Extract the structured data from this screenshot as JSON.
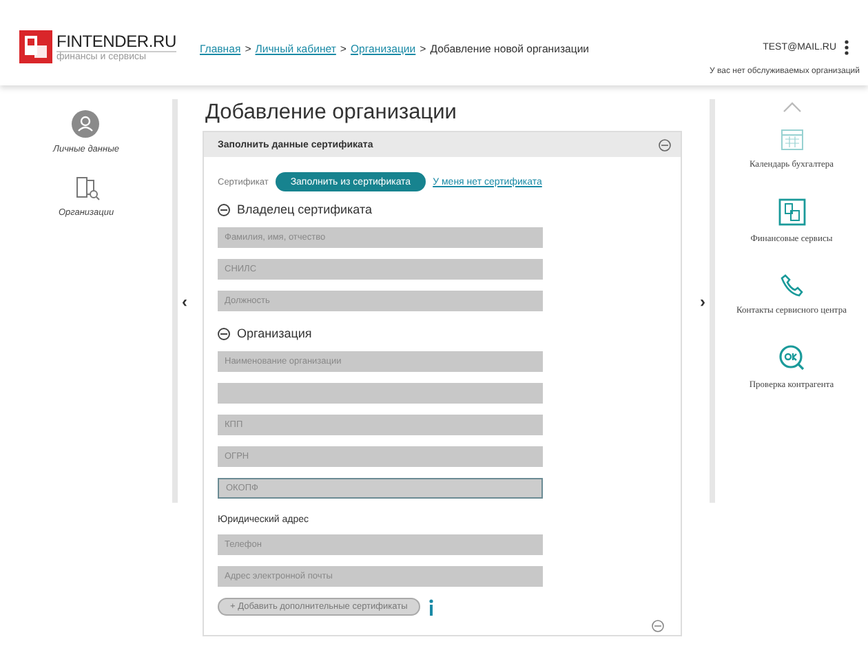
{
  "header": {
    "logo": {
      "name": "FINTENDER.RU",
      "tagline": "финансы и сервисы"
    },
    "breadcrumbs": [
      {
        "label": "Главная",
        "link": true
      },
      {
        "separator": ">",
        "label": "Личный кабинет",
        "link": true
      },
      {
        "separator": ">",
        "label": "Организации",
        "link": true
      },
      {
        "separator": ">",
        "label": "Добавление новой организации",
        "link": false
      }
    ],
    "user": "TEST@MAIL.RU",
    "note": "У вас нет обслуживаемых организаций"
  },
  "left_sidebar": [
    {
      "label": "Личные данные"
    },
    {
      "label": "Организации"
    }
  ],
  "left_arrow": "‹",
  "page_title": "Добавление организации",
  "card": {
    "title": "Заполнить данные сертификата",
    "certificate_label": "Сертификат",
    "fill_button": "Заполнить из сертификата",
    "no_cert_link": "У меня нет сертификата",
    "sections": [
      {
        "kind": "group",
        "title": "Владелец сертификата",
        "fields": [
          {
            "placeholder": "Фамилия, имя, отчество",
            "focused": false
          },
          {
            "placeholder": "СНИЛС",
            "focused": false
          },
          {
            "placeholder": "Должность",
            "focused": false
          }
        ]
      },
      {
        "kind": "group",
        "title": "Организация",
        "fields": [
          {
            "placeholder": "Наименование организации",
            "focused": false
          },
          {
            "focused": false
          },
          {
            "placeholder": "КПП",
            "focused": false
          },
          {
            "placeholder": "ОГРН",
            "focused": false
          },
          {
            "placeholder": "ОКОПФ",
            "focused": true
          }
        ]
      },
      {
        "kind": "plain",
        "title": "Юридический адрес",
        "fields": [
          {
            "placeholder": "Телефон",
            "focused": false
          },
          {
            "placeholder": "Адрес электронной почты",
            "focused": false
          }
        ]
      }
    ],
    "add_button": "+ Добавить дополнительные сертификаты"
  },
  "right_arrow": "›",
  "right_sidebar": [
    {
      "label": "Календарь бухгалтера",
      "active": false
    },
    {
      "label": "Финансовые сервисы",
      "active": true
    },
    {
      "label": "Контакты сервисного центра",
      "active": true
    },
    {
      "label": "Проверка контрагента",
      "active": true
    }
  ]
}
